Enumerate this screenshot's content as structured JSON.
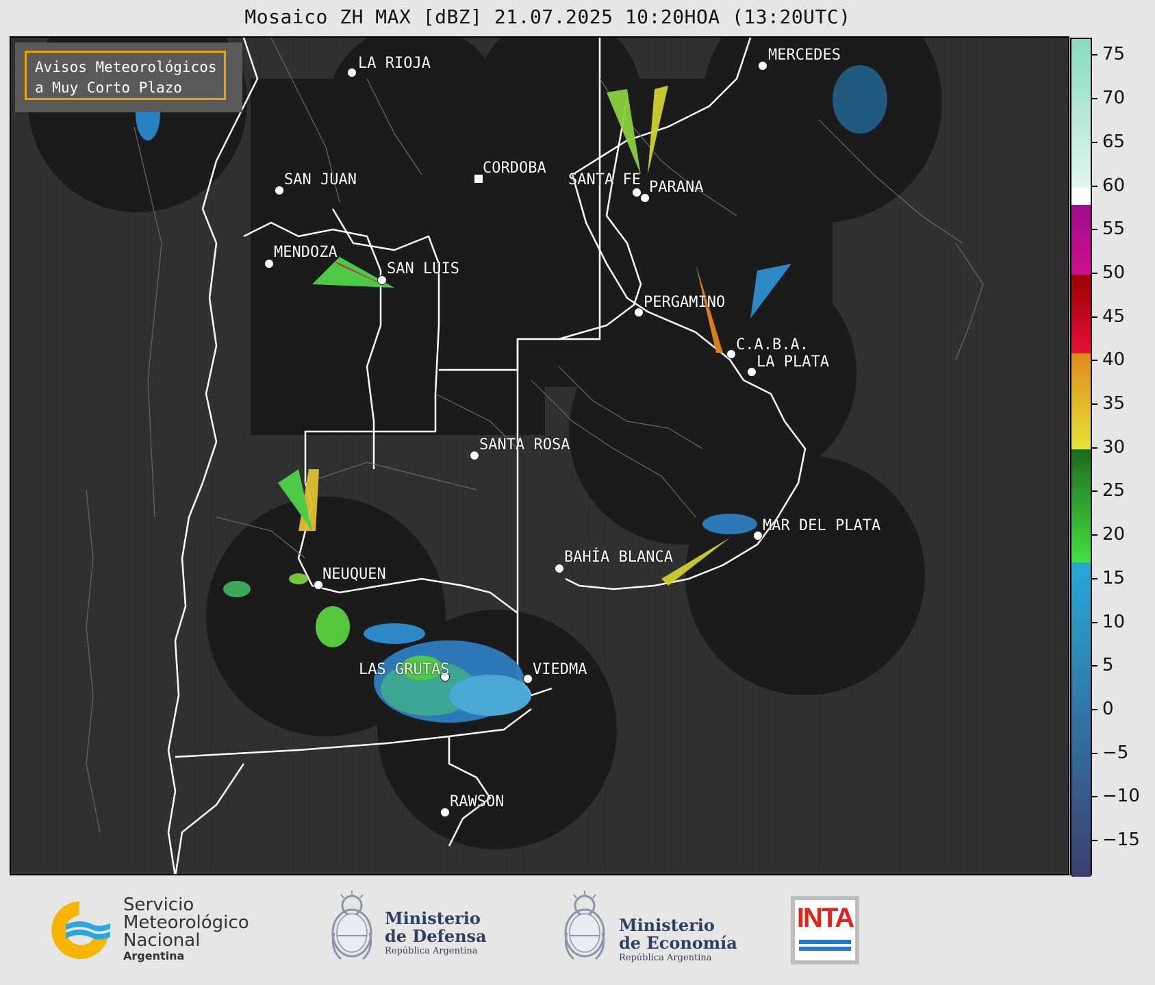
{
  "title": "Mosaico ZH MAX [dBZ] 21.07.2025 10:20HOA (13:20UTC)",
  "notice": {
    "line1": "Avisos Meteorológicos",
    "line2": "a Muy Corto Plazo",
    "border_color": "#f2a000"
  },
  "cities": [
    {
      "name": "LA RIOJA"
    },
    {
      "name": "MERCEDES"
    },
    {
      "name": "CORDOBA"
    },
    {
      "name": "SAN JUAN"
    },
    {
      "name": "SANTA FE"
    },
    {
      "name": "PARANA"
    },
    {
      "name": "MENDOZA"
    },
    {
      "name": "SAN LUIS"
    },
    {
      "name": "PERGAMINO"
    },
    {
      "name": "C.A.B.A."
    },
    {
      "name": "LA PLATA"
    },
    {
      "name": "SANTA ROSA"
    },
    {
      "name": "MAR DEL PLATA"
    },
    {
      "name": "BAHÍA BLANCA"
    },
    {
      "name": "NEUQUEN"
    },
    {
      "name": "LAS GRUTAS"
    },
    {
      "name": "VIEDMA"
    },
    {
      "name": "RAWSON"
    }
  ],
  "colorbar": {
    "unit": "dBZ",
    "min": -19,
    "max": 77,
    "ticks": [
      "75",
      "70",
      "65",
      "60",
      "55",
      "50",
      "45",
      "40",
      "35",
      "30",
      "25",
      "20",
      "15",
      "10",
      "5",
      "0",
      "−5",
      "−10",
      "−15"
    ],
    "bands": [
      {
        "from": -19,
        "to": 17,
        "color_top": "#27a9d9",
        "color_bottom": "#3b3f6e"
      },
      {
        "from": 17,
        "to": 30,
        "color_top": "#1e6a1e",
        "color_bottom": "#44e040"
      },
      {
        "from": 30,
        "to": 41,
        "color_top": "#e08a1a",
        "color_bottom": "#e7e33a"
      },
      {
        "from": 41,
        "to": 50,
        "color_top": "#9a0000",
        "color_bottom": "#e8103a"
      },
      {
        "from": 50,
        "to": 58,
        "color_top": "#9d0b8d",
        "color_bottom": "#d0108a"
      },
      {
        "from": 58,
        "to": 60,
        "color_top": "#ffffff",
        "color_bottom": "#ffffff"
      },
      {
        "from": 60,
        "to": 77,
        "color_top": "#86dcc0",
        "color_bottom": "#e4f6ee"
      }
    ]
  },
  "footer": {
    "smn": {
      "line1": "Servicio",
      "line2": "Meteorológico",
      "line3": "Nacional",
      "line4": "Argentina"
    },
    "defensa": {
      "line1": "Ministerio",
      "line2": "de Defensa",
      "line3": "República Argentina"
    },
    "economia": {
      "line1": "Ministerio",
      "line2": "de Economía",
      "line3": "República Argentina"
    },
    "inta": {
      "label": "INTA",
      "color": "#e2231a"
    }
  }
}
